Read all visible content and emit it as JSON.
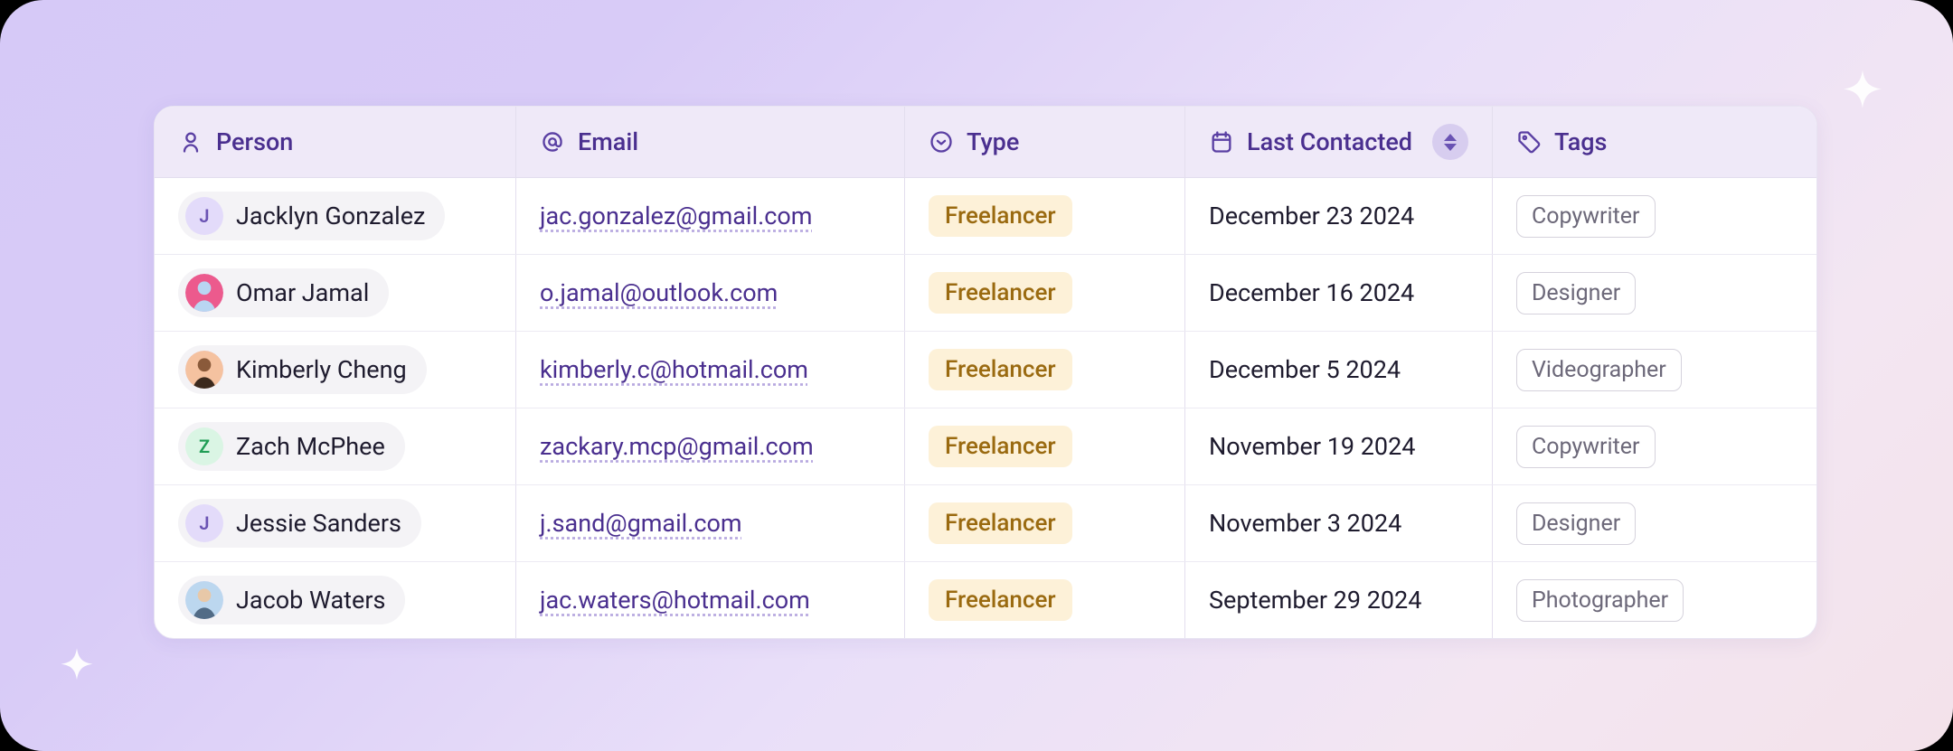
{
  "columns": {
    "person": "Person",
    "email": "Email",
    "type": "Type",
    "last_contacted": "Last Contacted",
    "tags": "Tags"
  },
  "rows": [
    {
      "initial": "J",
      "avatar_style": "letter-purple",
      "name": "Jacklyn Gonzalez",
      "email": "jac.gonzalez@gmail.com",
      "type": "Freelancer",
      "last_contacted": "December 23 2024",
      "tag": "Copywriter"
    },
    {
      "initial": "",
      "avatar_style": "photo-pink",
      "name": "Omar Jamal",
      "email": "o.jamal@outlook.com",
      "type": "Freelancer",
      "last_contacted": "December 16 2024",
      "tag": "Designer"
    },
    {
      "initial": "",
      "avatar_style": "photo-peach",
      "name": "Kimberly Cheng",
      "email": "kimberly.c@hotmail.com",
      "type": "Freelancer",
      "last_contacted": "December 5 2024",
      "tag": "Videographer"
    },
    {
      "initial": "Z",
      "avatar_style": "letter-green",
      "name": "Zach McPhee",
      "email": "zackary.mcp@gmail.com",
      "type": "Freelancer",
      "last_contacted": "November 19 2024",
      "tag": "Copywriter"
    },
    {
      "initial": "J",
      "avatar_style": "letter-purple",
      "name": "Jessie Sanders",
      "email": "j.sand@gmail.com",
      "type": "Freelancer",
      "last_contacted": "November 3 2024",
      "tag": "Designer"
    },
    {
      "initial": "",
      "avatar_style": "photo-blue",
      "name": "Jacob Waters",
      "email": "jac.waters@hotmail.com",
      "type": "Freelancer",
      "last_contacted": "September 29 2024",
      "tag": "Photographer"
    }
  ]
}
